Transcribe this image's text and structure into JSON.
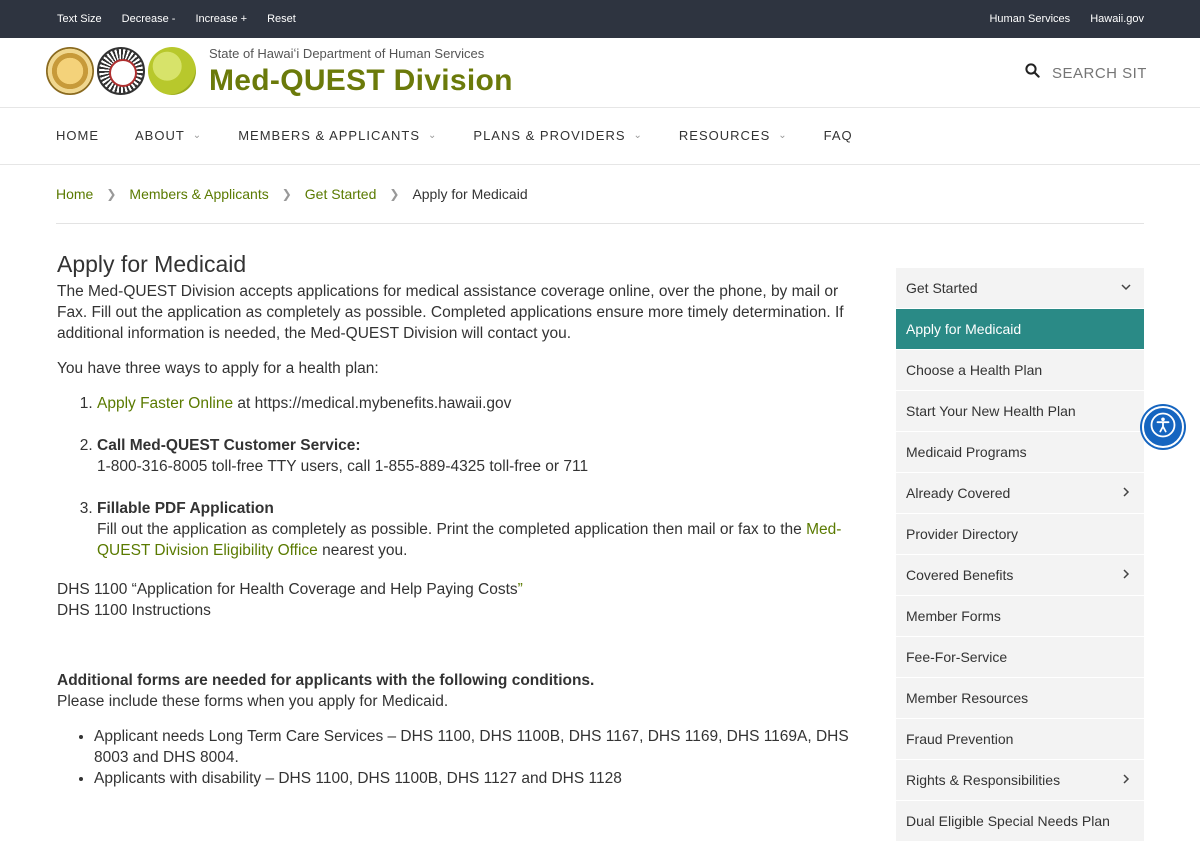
{
  "topbar": {
    "text_size": "Text Size",
    "decrease": "Decrease -",
    "increase": "Increase +",
    "reset": "Reset",
    "human_services": "Human Services",
    "hawaii_gov": "Hawaii.gov"
  },
  "header": {
    "department": "State of Hawaiʻi Department of Human Services",
    "division": "Med-QUEST Division",
    "search_placeholder": "SEARCH SITE"
  },
  "nav": {
    "items": [
      {
        "label": "HOME",
        "has_dropdown": false
      },
      {
        "label": "ABOUT",
        "has_dropdown": true
      },
      {
        "label": "MEMBERS & APPLICANTS",
        "has_dropdown": true
      },
      {
        "label": "PLANS & PROVIDERS",
        "has_dropdown": true
      },
      {
        "label": "RESOURCES",
        "has_dropdown": true
      },
      {
        "label": "FAQ",
        "has_dropdown": false
      }
    ]
  },
  "breadcrumb": {
    "home": "Home",
    "members": "Members & Applicants",
    "get_started": "Get Started",
    "current": "Apply for Medicaid"
  },
  "main": {
    "title": "Apply for Medicaid",
    "intro": "The Med-QUEST Division accepts applications for medical assistance coverage online, over the phone, by mail or Fax.  Fill out the application as completely as possible. Completed applications ensure more timely determination.  If additional information is needed, the Med-QUEST Division will contact you.",
    "ways_heading": "You have three ways to apply for a health plan:",
    "way1_link": "Apply Faster Online",
    "way1_text": " at https://medical.mybenefits.hawaii.gov",
    "way2_title": "Call Med-QUEST Customer Service:",
    "way2_text": "1-800-316-8005 toll-free TTY users, call 1-855-889-4325 toll-free or 711",
    "way3_title": "Fillable PDF Application",
    "way3_text": "Fill out the application as completely as possible.  Print the completed application then mail or fax to the ",
    "way3_link": "Med-QUEST Division Eligibility Office",
    "way3_tail": " nearest you.",
    "dhs1100": "DHS 1100 “Application for Health Coverage and Help Paying Costs",
    "dhs1100_quote": "”",
    "dhs1100_instructions": "DHS 1100 Instructions",
    "additional_heading": "Additional forms are needed for applicants with the following conditions.",
    "additional_sub": "Please include these forms when you apply for Medicaid.",
    "conditions": [
      "Applicant needs Long Term Care Services – DHS 1100, DHS 1100B, DHS 1167, DHS 1169, DHS 1169A, DHS 8003 and DHS 8004.",
      "Applicants with disability – DHS 1100, DHS 1100B, DHS 1127 and DHS 1128"
    ]
  },
  "sidebar": {
    "items": [
      {
        "label": "Get Started",
        "icon": "chevron-down-icon"
      },
      {
        "label": "Apply for Medicaid",
        "icon": ""
      },
      {
        "label": "Choose a Health Plan",
        "icon": ""
      },
      {
        "label": "Start Your New Health Plan",
        "icon": ""
      },
      {
        "label": "Medicaid Programs",
        "icon": ""
      },
      {
        "label": "Already Covered",
        "icon": "chevron-right-icon"
      },
      {
        "label": "Provider Directory",
        "icon": ""
      },
      {
        "label": "Covered Benefits",
        "icon": "chevron-right-icon"
      },
      {
        "label": "Member Forms",
        "icon": ""
      },
      {
        "label": "Fee-For-Service",
        "icon": ""
      },
      {
        "label": "Member Resources",
        "icon": ""
      },
      {
        "label": "Fraud Prevention",
        "icon": ""
      },
      {
        "label": "Rights & Responsibilities",
        "icon": "chevron-right-icon"
      },
      {
        "label": "Dual Eligible Special Needs Plan",
        "icon": ""
      }
    ]
  },
  "colors": {
    "topbar_bg": "#2e3440",
    "brand_green": "#6b7a0a",
    "link_green": "#5a7a00",
    "sidebar_active": "#2a8a86",
    "accessibility_blue": "#1565c0"
  }
}
